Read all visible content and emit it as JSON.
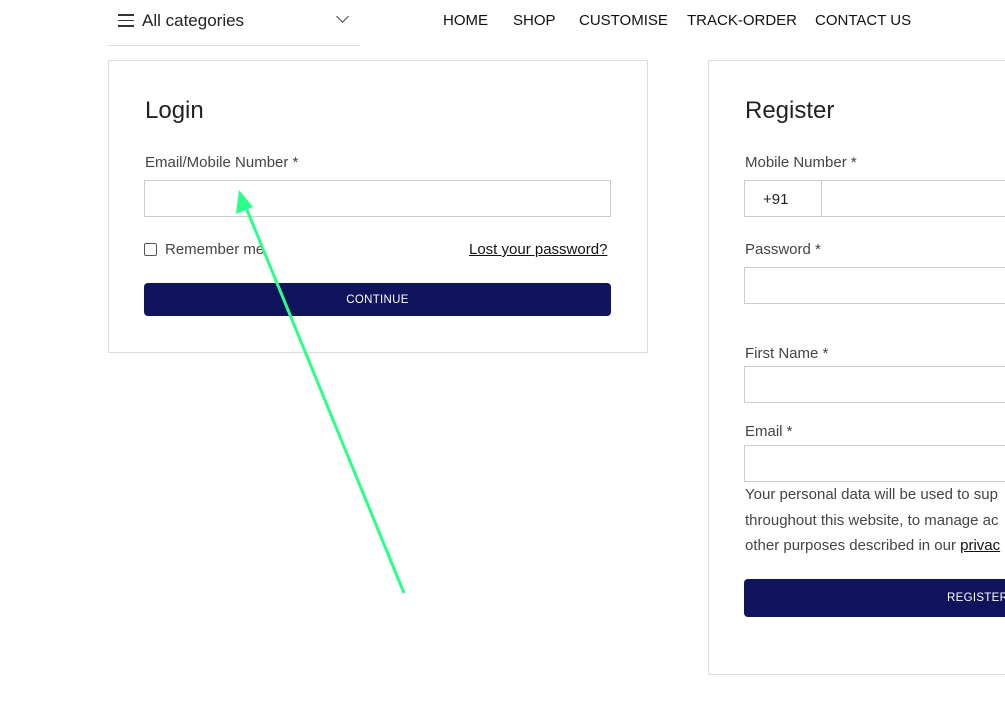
{
  "header": {
    "categories_label": "All categories",
    "nav": [
      "HOME",
      "SHOP",
      "CUSTOMISE",
      "TRACK-ORDER",
      "CONTACT US"
    ]
  },
  "login": {
    "title": "Login",
    "email_label": "Email/Mobile Number *",
    "email_value": "",
    "remember_label": "Remember me",
    "remember_checked": false,
    "lost_password": "Lost your password?",
    "continue": "CONTINUE"
  },
  "register": {
    "title": "Register",
    "mobile_label": "Mobile Number *",
    "country_code": "+91",
    "password_label": "Password *",
    "first_name_label": "First Name *",
    "email_label": "Email *",
    "privacy_line1": "Your personal data will be used to sup",
    "privacy_line2": "throughout this website, to manage ac",
    "privacy_line3": "other purposes described in our ",
    "privacy_link": "privac",
    "register": "REGISTER"
  },
  "colors": {
    "button": "#0f145c",
    "annotation_arrow": "#2bff88"
  }
}
